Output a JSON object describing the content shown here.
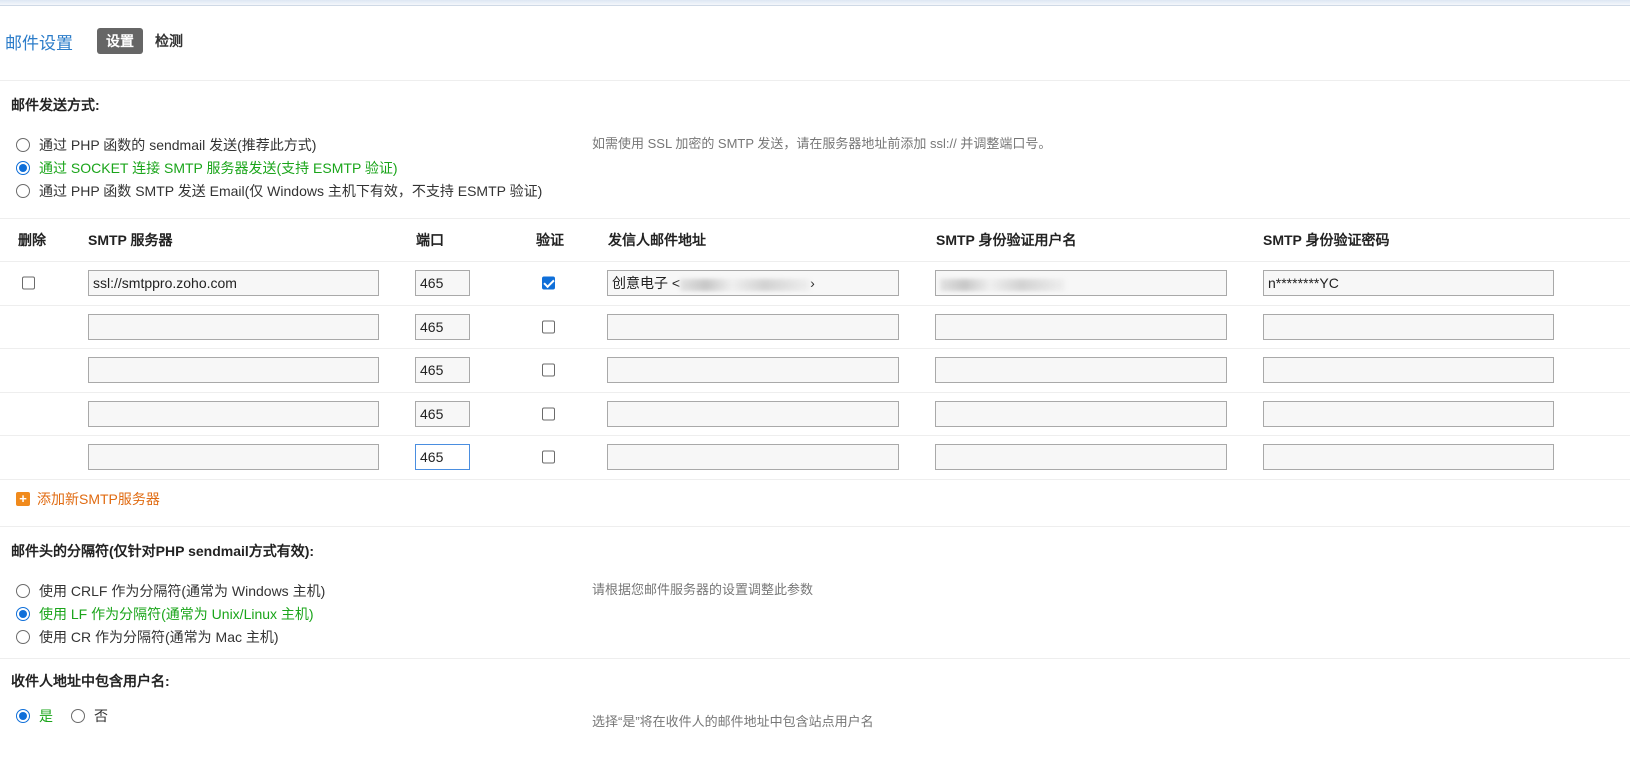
{
  "header": {
    "title": "邮件设置",
    "tabs": [
      {
        "label": "设置",
        "active": true
      },
      {
        "label": "检测",
        "active": false
      }
    ]
  },
  "send_method": {
    "title": "邮件发送方式:",
    "options": [
      {
        "label": "通过 PHP 函数的 sendmail 发送(推荐此方式)",
        "selected": false
      },
      {
        "label": "通过 SOCKET 连接 SMTP 服务器发送(支持 ESMTP 验证)",
        "selected": true
      },
      {
        "label": "通过 PHP 函数 SMTP 发送 Email(仅 Windows 主机下有效，不支持 ESMTP 验证)",
        "selected": false
      }
    ],
    "hint": "如需使用 SSL 加密的 SMTP 发送，请在服务器地址前添加 ssl:// 并调整端口号。"
  },
  "smtp_table": {
    "columns": [
      "删除",
      "SMTP 服务器",
      "端口",
      "验证",
      "发信人邮件地址",
      "SMTP 身份验证用户名",
      "SMTP 身份验证密码"
    ],
    "rows": [
      {
        "deletable": true,
        "server": "ssl://smtppro.zoho.com",
        "port": "465",
        "auth": true,
        "from": "创意电子 <",
        "from_end": "›",
        "user": "",
        "password": "n********YC"
      },
      {
        "deletable": false,
        "server": "",
        "port": "465",
        "auth": false,
        "from": "",
        "from_end": "",
        "user": "",
        "password": ""
      },
      {
        "deletable": false,
        "server": "",
        "port": "465",
        "auth": false,
        "from": "",
        "from_end": "",
        "user": "",
        "password": ""
      },
      {
        "deletable": false,
        "server": "",
        "port": "465",
        "auth": false,
        "from": "",
        "from_end": "",
        "user": "",
        "password": ""
      },
      {
        "deletable": false,
        "server": "",
        "port": "465",
        "auth": false,
        "from": "",
        "from_end": "",
        "user": "",
        "password": ""
      }
    ],
    "add_label": "添加新SMTP服务器"
  },
  "separator": {
    "title": "邮件头的分隔符(仅针对PHP sendmail方式有效):",
    "options": [
      {
        "label": "使用 CRLF 作为分隔符(通常为 Windows 主机)",
        "selected": false
      },
      {
        "label": "使用 LF 作为分隔符(通常为 Unix/Linux 主机)",
        "selected": true
      },
      {
        "label": "使用 CR 作为分隔符(通常为 Mac 主机)",
        "selected": false
      }
    ],
    "hint": "请根据您邮件服务器的设置调整此参数"
  },
  "include_username": {
    "title": "收件人地址中包含用户名:",
    "options": [
      {
        "label": "是",
        "selected": true
      },
      {
        "label": "否",
        "selected": false
      }
    ],
    "hint": "选择“是”将在收件人的邮件地址中包含站点用户名"
  },
  "colors": {
    "accent": "#2b7cc9",
    "selected_text": "#1aa51a",
    "radio": "#0f6fd9",
    "add_link": "#e06b12"
  }
}
